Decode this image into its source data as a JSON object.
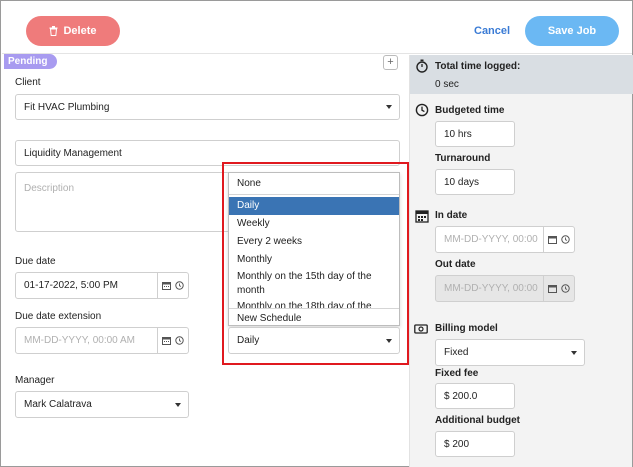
{
  "topbar": {
    "delete_label": "Delete",
    "cancel_label": "Cancel",
    "save_label": "Save Job"
  },
  "status_badge": "Pending",
  "client": {
    "label": "Client",
    "value": "Fit HVAC Plumbing"
  },
  "job_name": "Liquidity Management",
  "description_placeholder": "Description",
  "due_date": {
    "label": "Due date",
    "value": "01-17-2022, 5:00 PM"
  },
  "due_date_extension": {
    "label": "Due date extension",
    "placeholder": "MM-DD-YYYY, 00:00 AM"
  },
  "manager": {
    "label": "Manager",
    "value": "Mark Calatrava"
  },
  "schedule": {
    "options": [
      "None",
      "Daily",
      "Weekly",
      "Every 2 weeks",
      "Monthly",
      "Monthly on the 15th day of the month",
      "Monthly on the 18th day of the"
    ],
    "selected_index": 1,
    "new_schedule_label": "New Schedule",
    "value": "Daily"
  },
  "right": {
    "total_time_label": "Total time logged:",
    "total_time_value": "0 sec",
    "budgeted_label": "Budgeted time",
    "budgeted_value": "10 hrs",
    "turnaround_label": "Turnaround",
    "turnaround_value": "10 days",
    "in_date_label": "In date",
    "in_date_placeholder": "MM-DD-YYYY, 00:00",
    "out_date_label": "Out date",
    "out_date_placeholder": "MM-DD-YYYY, 00:00",
    "billing_label": "Billing model",
    "billing_value": "Fixed",
    "fixed_fee_label": "Fixed fee",
    "fixed_fee_value": "$ 200.0",
    "additional_budget_label": "Additional budget",
    "additional_budget_value": "$ 200"
  },
  "colors": {
    "delete": "#ef7b7b",
    "save": "#6bb8f3",
    "badge": "#a89bf0",
    "selected": "#3a74b4",
    "highlight": "#e0191f"
  }
}
